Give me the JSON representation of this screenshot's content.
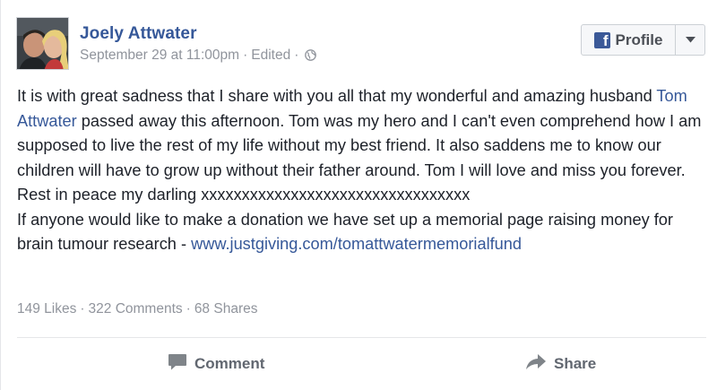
{
  "post": {
    "author": "Joely Attwater",
    "date": "September 29 at 11:00pm",
    "edited": "Edited",
    "privacy_icon": "globe-icon",
    "profile_button": "Profile",
    "paragraph1_part1": "It is with great sadness that I share with you all that my wonderful and amazing husband ",
    "tagged_name": "Tom Attwater",
    "paragraph1_part2": " passed away this afternoon. Tom was my hero and I can't even comprehend how I am supposed to live the rest of my life without my best friend. It also saddens me to know our children will have to grow up without their father around. Tom I will love and miss you forever. Rest in peace my darling xxxxxxxxxxxxxxxxxxxxxxxxxxxxxxxxx",
    "paragraph2_part1": "If anyone would like to make a donation we have set up a memorial page raising money for brain tumour research - ",
    "donation_link": "www.justgiving.com/tomattwatermemorialfund"
  },
  "stats": {
    "likes": "149 Likes",
    "comments": "322 Comments",
    "shares": "68 Shares"
  },
  "actions": {
    "comment": "Comment",
    "share": "Share"
  },
  "colors": {
    "link": "#365899",
    "meta": "#90949c",
    "facebook_blue": "#3b5998"
  }
}
